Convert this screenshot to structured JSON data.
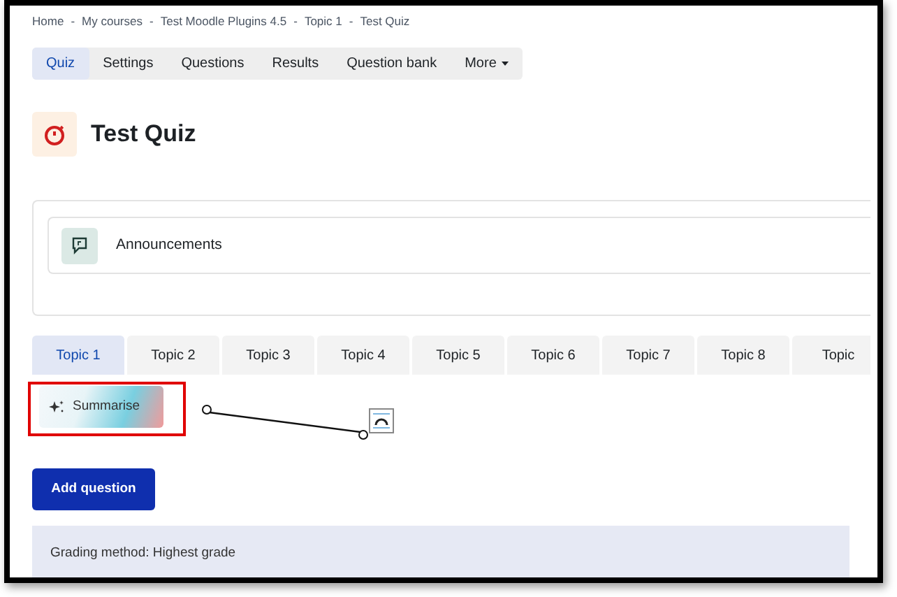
{
  "breadcrumb": [
    {
      "label": "Home"
    },
    {
      "separator": "-",
      "label": "My courses"
    },
    {
      "separator": "-",
      "label": "Test Moodle Plugins 4.5"
    },
    {
      "separator": "-",
      "label": "Topic 1"
    },
    {
      "separator": "-",
      "label": "Test Quiz"
    }
  ],
  "nav_tabs": [
    {
      "label": "Quiz",
      "selected": true
    },
    {
      "label": "Settings",
      "selected": false
    },
    {
      "label": "Questions",
      "selected": false
    },
    {
      "label": "Results",
      "selected": false
    },
    {
      "label": "Question bank",
      "selected": false
    },
    {
      "label": "More",
      "selected": false,
      "dropdown": true
    }
  ],
  "title": "Test Quiz",
  "announcements": "Announcements",
  "topic_tabs": [
    {
      "label": "Topic 1",
      "selected": true
    },
    {
      "label": "Topic 2",
      "selected": false
    },
    {
      "label": "Topic 3",
      "selected": false
    },
    {
      "label": "Topic 4",
      "selected": false
    },
    {
      "label": "Topic 5",
      "selected": false
    },
    {
      "label": "Topic 6",
      "selected": false
    },
    {
      "label": "Topic 7",
      "selected": false
    },
    {
      "label": "Topic 8",
      "selected": false
    },
    {
      "label": "Topic",
      "selected": false
    }
  ],
  "summarise_button": "Summarise",
  "add_question_button": "Add question",
  "grading_method": "Grading method: Highest grade"
}
